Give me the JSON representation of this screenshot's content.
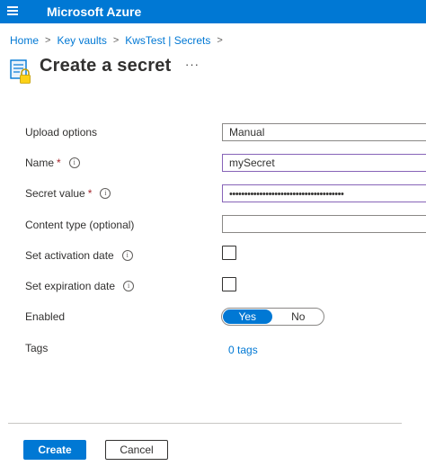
{
  "app": {
    "title": "Microsoft Azure",
    "menu_icon": "hamburger-menu-icon"
  },
  "breadcrumb": [
    "Home",
    "Key vaults",
    "KwsTest | Secrets"
  ],
  "breadcrumb_separator": ">",
  "page": {
    "title": "Create a secret",
    "more_label": "···",
    "icon": "key-vault-secret-icon"
  },
  "form": {
    "upload_options": {
      "label": "Upload options",
      "value": "Manual"
    },
    "name": {
      "label": "Name",
      "required_mark": "*",
      "value": "mySecret",
      "info_icon": "i"
    },
    "secret_value": {
      "label": "Secret value",
      "required_mark": "*",
      "value": "••••••••••••••••••••••••••••••••••••••",
      "info_icon": "i"
    },
    "content_type": {
      "label": "Content type (optional)",
      "value": ""
    },
    "activation_date": {
      "label": "Set activation date",
      "info_icon": "i",
      "checked": false
    },
    "expiration_date": {
      "label": "Set expiration date",
      "info_icon": "i",
      "checked": false
    },
    "enabled": {
      "label": "Enabled",
      "options": [
        "Yes",
        "No"
      ],
      "selected": "Yes"
    },
    "tags": {
      "label": "Tags",
      "link": "0 tags"
    }
  },
  "actions": {
    "create_label": "Create",
    "cancel_label": "Cancel"
  },
  "colors": {
    "accent": "#0078d4",
    "active_border": "#8764b8",
    "required": "#a4262c"
  }
}
